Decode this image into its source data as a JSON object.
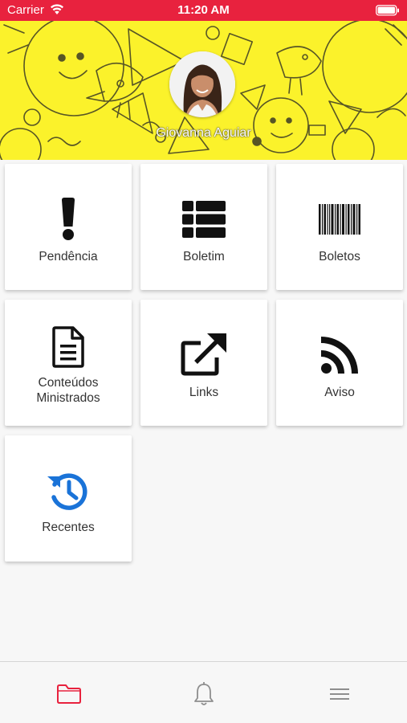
{
  "status_bar": {
    "carrier": "Carrier",
    "time": "11:20 AM",
    "background_color": "#e8223e"
  },
  "header": {
    "background_color": "#fbf22b",
    "user_name": "Giovanna Aguiar"
  },
  "menu": {
    "items": [
      {
        "label": "Pendência",
        "icon": "exclamation-icon"
      },
      {
        "label": "Boletim",
        "icon": "table-list-icon"
      },
      {
        "label": "Boletos",
        "icon": "barcode-icon"
      },
      {
        "label": "Conteúdos\nMinistrados",
        "icon": "document-icon"
      },
      {
        "label": "Links",
        "icon": "external-link-icon"
      },
      {
        "label": "Aviso",
        "icon": "rss-icon"
      },
      {
        "label": "Recentes",
        "icon": "history-icon"
      }
    ],
    "recentes_icon_color": "#1a73d8"
  },
  "tab_bar": {
    "tabs": [
      {
        "icon": "folder-icon",
        "active": true
      },
      {
        "icon": "bell-icon",
        "active": false
      },
      {
        "icon": "menu-icon",
        "active": false
      }
    ],
    "active_color": "#e8223e",
    "inactive_color": "#8e8e8e"
  }
}
